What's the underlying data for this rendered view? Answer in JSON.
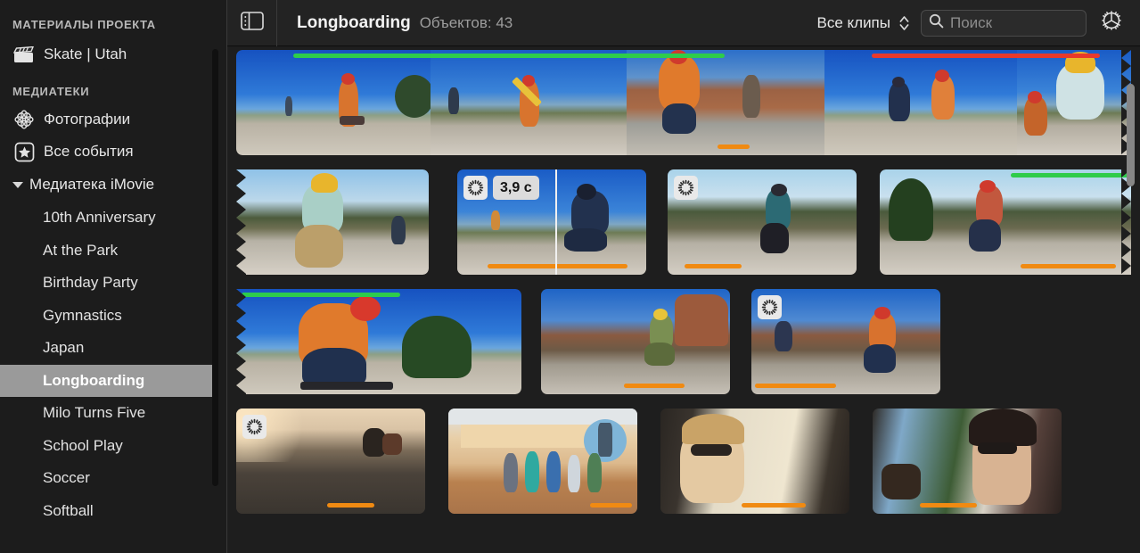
{
  "sidebar": {
    "sections": [
      {
        "title": "МАТЕРИАЛЫ ПРОЕКТА"
      },
      {
        "title": "МЕДИАТЕКИ"
      }
    ],
    "project_item": {
      "label": "Skate | Utah",
      "icon": "clapperboard-icon"
    },
    "libraries": [
      {
        "label": "Фотографии",
        "icon": "photos-flower-icon"
      },
      {
        "label": "Все события",
        "icon": "star-box-icon"
      }
    ],
    "library_group": {
      "label": "Медиатека iMovie",
      "expanded": true
    },
    "events": [
      {
        "label": "10th Anniversary",
        "selected": false
      },
      {
        "label": "At the Park",
        "selected": false
      },
      {
        "label": "Birthday Party",
        "selected": false
      },
      {
        "label": "Gymnastics",
        "selected": false
      },
      {
        "label": "Japan",
        "selected": false
      },
      {
        "label": "Longboarding",
        "selected": true
      },
      {
        "label": "Milo Turns Five",
        "selected": false
      },
      {
        "label": "School Play",
        "selected": false
      },
      {
        "label": "Soccer",
        "selected": false
      },
      {
        "label": "Softball",
        "selected": false
      }
    ]
  },
  "toolbar": {
    "sidebar_toggle_icon": "sidebar-panel-icon",
    "title": "Longboarding",
    "count_label": "Объектов: 43",
    "filter_label": "Все клипы",
    "filter_stepper_icon": "chevron-up-down-icon",
    "search_icon": "search-icon",
    "search_value": "",
    "search_placeholder": "Поиск",
    "settings_icon": "gear-icon"
  },
  "browser": {
    "selection_badge": {
      "duration": "3,9 с",
      "spinner_icon": "processing-spinner-icon"
    },
    "colors": {
      "favorite_bar": "#f08a12",
      "keyword_green": "#2ecc4b",
      "rejected_red": "#e8392b",
      "selection_gray": "#9a9a9a"
    },
    "rows": [
      {
        "clips": [
          {
            "scene": "sky-deep",
            "top_bar": "green",
            "top_bar_from": 0.07,
            "top_bar_to": 0.55,
            "bottom_bar": null
          },
          {
            "scene": "sky-mid",
            "top_bar": null,
            "bottom_bar": null
          },
          {
            "scene": "scene-red",
            "top_bar": null,
            "bottom_bar": {
              "from": 0.46,
              "to": 0.62
            }
          },
          {
            "scene": "sky-deep",
            "top_bar": "red",
            "top_bar_from": 0.72,
            "top_bar_to": 0.98,
            "bottom_bar": null
          },
          {
            "scene": "sky-mid",
            "top_bar": null,
            "bottom_bar": null
          }
        ]
      },
      {
        "clips": [
          {
            "scene": "sky-wide",
            "top_bar": null,
            "bottom_bar": null,
            "spinner": false
          },
          {
            "scene": "sky-mid",
            "top_bar": null,
            "bottom_bar": {
              "from": 0.16,
              "to": 0.9
            },
            "spinner": true,
            "duration": "3,9 с",
            "playhead": 0.52
          },
          {
            "scene": "scene-hill",
            "top_bar": null,
            "bottom_bar": {
              "from": 0.09,
              "to": 0.39
            },
            "spinner": true
          },
          {
            "scene": "scene-hill",
            "top_bar": "green",
            "top_bar_from": 0.52,
            "top_bar_to": 1.0,
            "bottom_bar": {
              "from": 0.56,
              "to": 0.94
            },
            "spinner": false
          }
        ]
      },
      {
        "clips": [
          {
            "scene": "sky-deep",
            "top_bar": "green",
            "top_bar_from": 0.02,
            "top_bar_to": 0.56,
            "bottom_bar": null
          },
          {
            "scene": "scene-canyon",
            "top_bar": null,
            "bottom_bar": {
              "from": 0.44,
              "to": 0.76
            }
          },
          {
            "scene": "scene-canyon",
            "top_bar": null,
            "bottom_bar": {
              "from": 0.02,
              "to": 0.45
            },
            "spinner": true
          }
        ]
      },
      {
        "clips": [
          {
            "scene": "scene-dusk",
            "top_bar": null,
            "bottom_bar": {
              "from": 0.48,
              "to": 0.73
            },
            "spinner": true
          },
          {
            "scene": "scene-post",
            "top_bar": null,
            "bottom_bar": {
              "from": 0.75,
              "to": 0.97
            }
          },
          {
            "scene": "scene-van1",
            "top_bar": null,
            "bottom_bar": {
              "from": 0.43,
              "to": 0.77
            }
          },
          {
            "scene": "scene-van2",
            "top_bar": null,
            "bottom_bar": {
              "from": 0.25,
              "to": 0.55
            }
          }
        ]
      }
    ]
  }
}
